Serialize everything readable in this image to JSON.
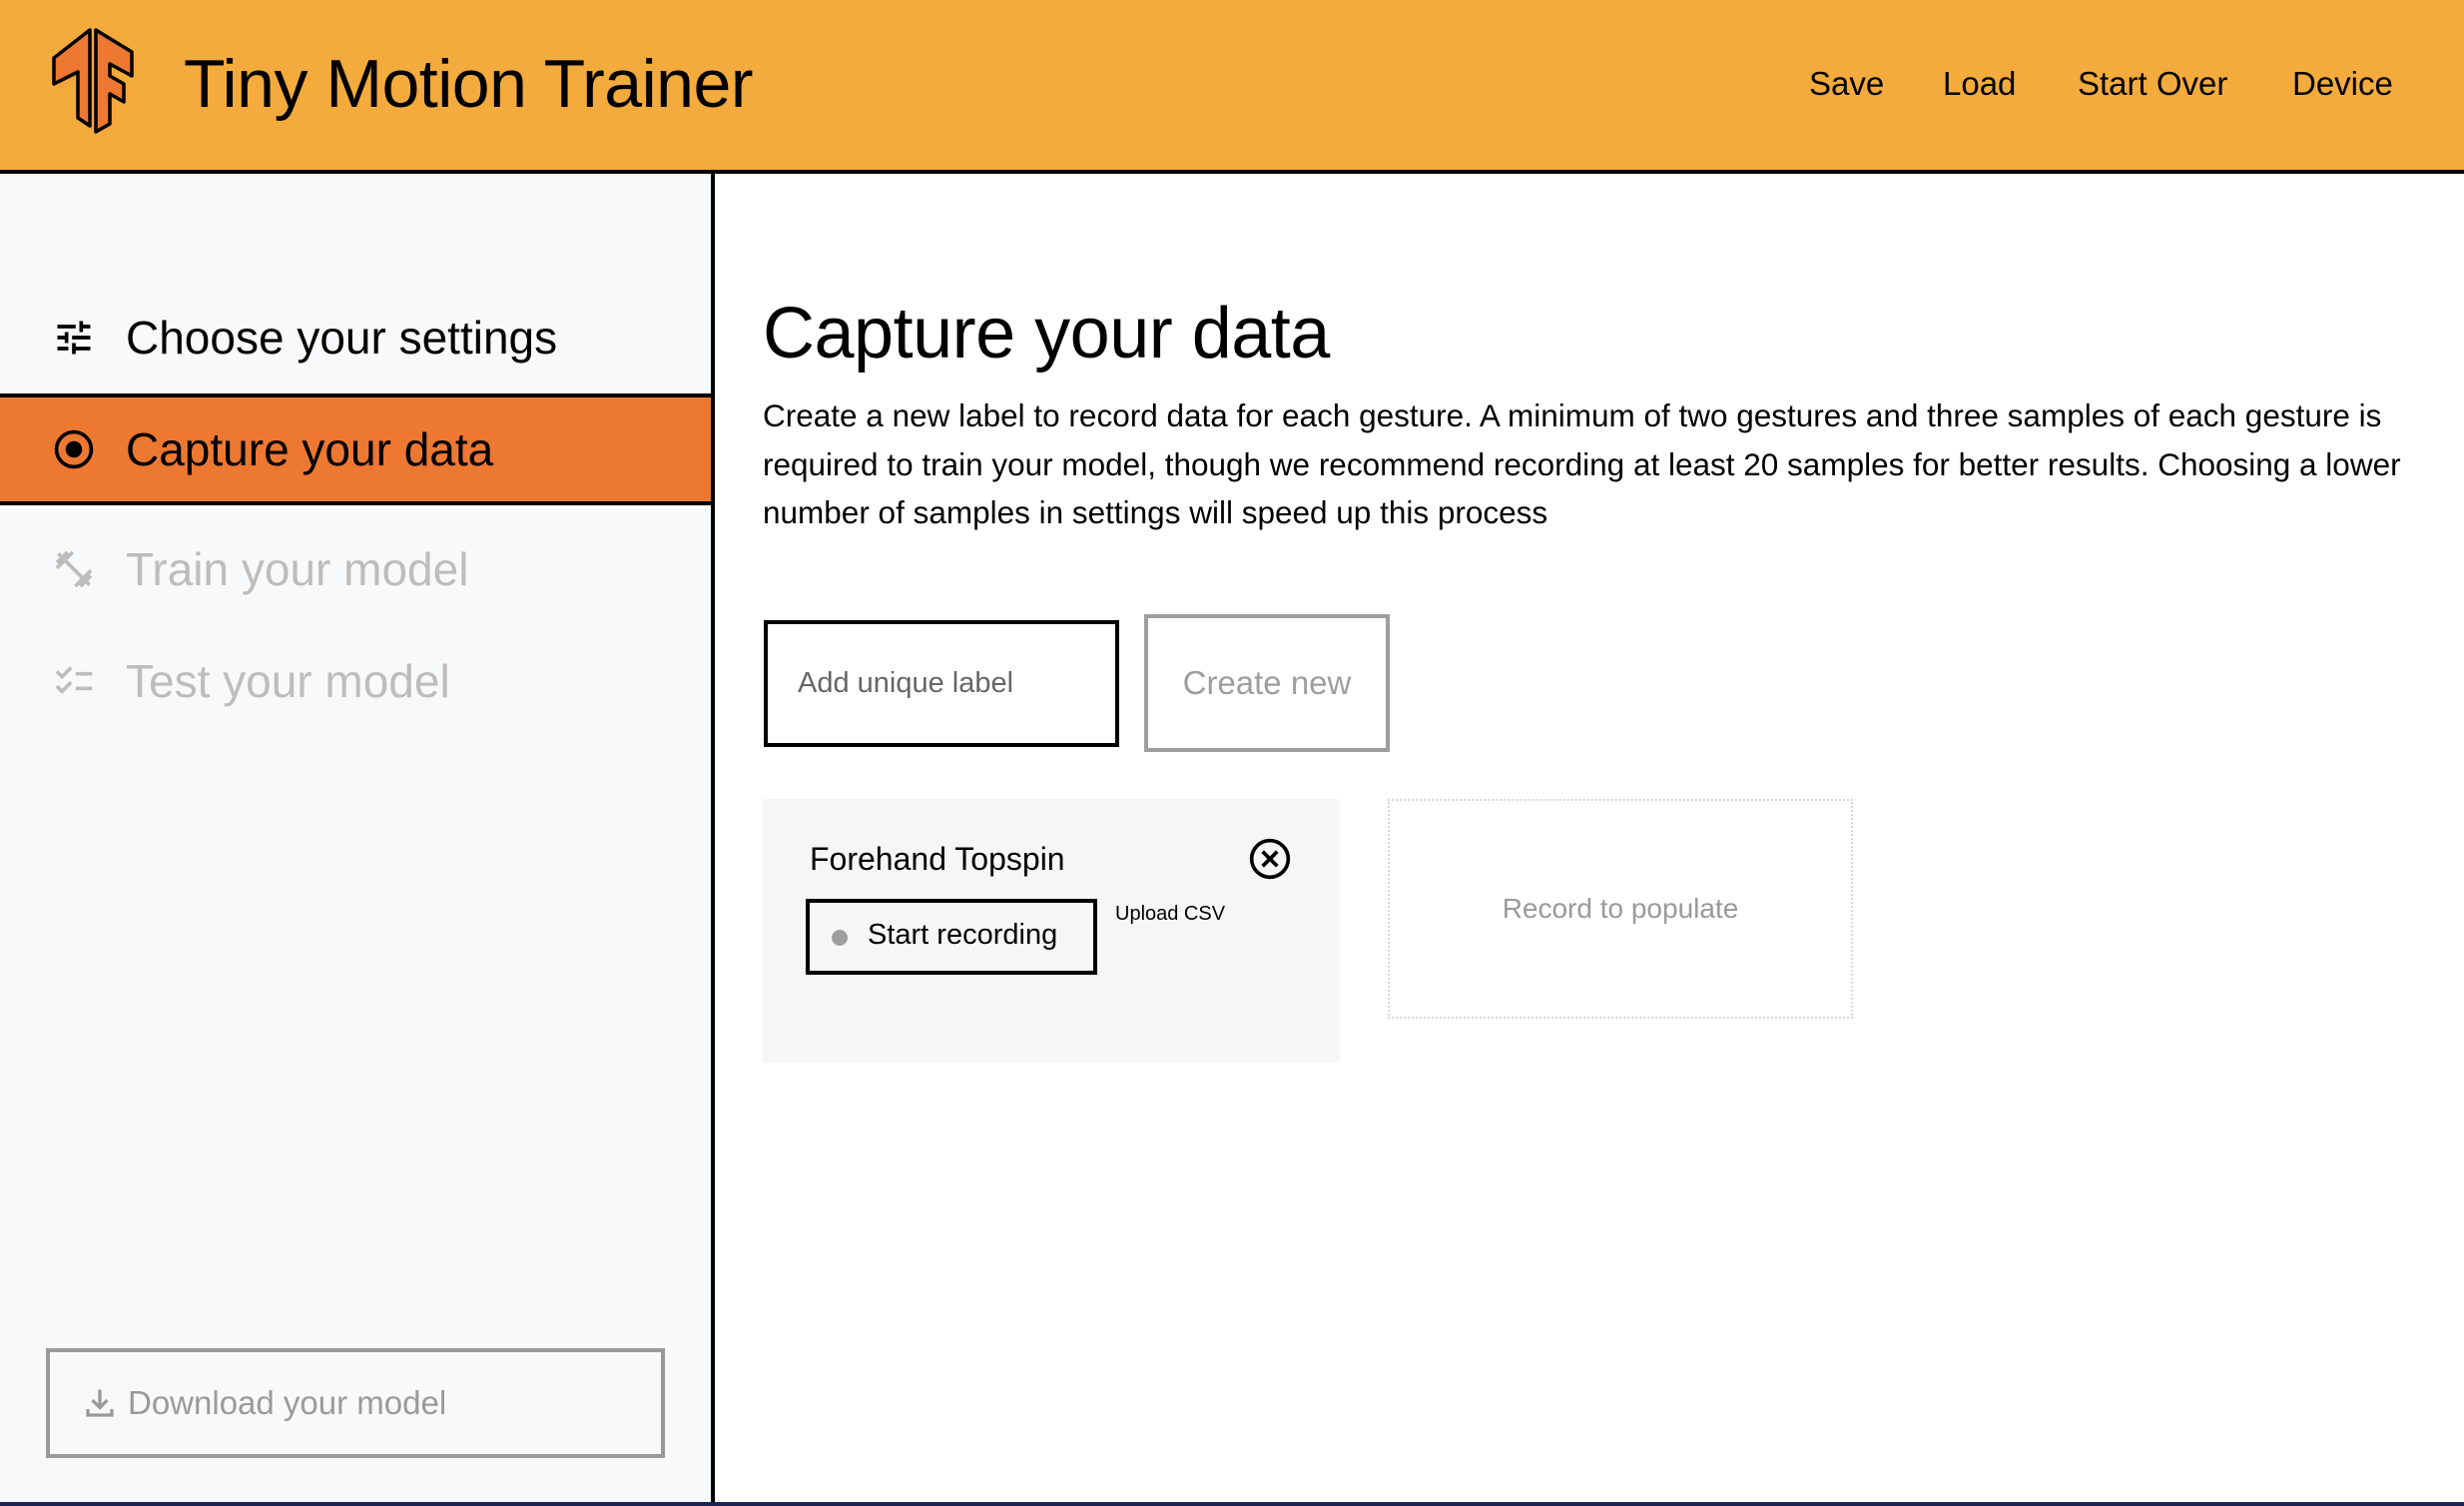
{
  "header": {
    "app_title": "Tiny Motion Trainer",
    "logo_icon": "tensorflow-logo-icon",
    "nav": [
      {
        "label": "Save"
      },
      {
        "label": "Load"
      },
      {
        "label": "Start Over"
      },
      {
        "label": "Device"
      }
    ]
  },
  "colors": {
    "header_bg": "#f4ab3d",
    "accent_active": "#ed7832",
    "sidebar_bg": "#f8f9fa",
    "disabled_text": "#bdbdbd"
  },
  "sidebar": {
    "items": [
      {
        "label": "Choose your settings",
        "icon": "tune-icon",
        "state": "enabled"
      },
      {
        "label": "Capture your data",
        "icon": "radio-target-icon",
        "state": "active"
      },
      {
        "label": "Train your model",
        "icon": "dumbbell-icon",
        "state": "disabled"
      },
      {
        "label": "Test your model",
        "icon": "checklist-icon",
        "state": "disabled"
      }
    ],
    "download_button": {
      "label": "Download your model",
      "icon": "download-icon"
    }
  },
  "main": {
    "title": "Capture your data",
    "description": "Create a new label to record data for each gesture. A minimum of two gestures and three samples of each gesture is required to train your model, though we recommend recording at least 20 samples for better results. Choosing a lower number of samples in settings will speed up this process",
    "label_input": {
      "placeholder": "Add unique label",
      "value": ""
    },
    "create_button": {
      "label": "Create new"
    },
    "gestures": [
      {
        "name": "Forehand Topspin",
        "record_button": "Start recording",
        "upload_link": "Upload CSV",
        "samples_placeholder": "Record to populate"
      }
    ]
  }
}
